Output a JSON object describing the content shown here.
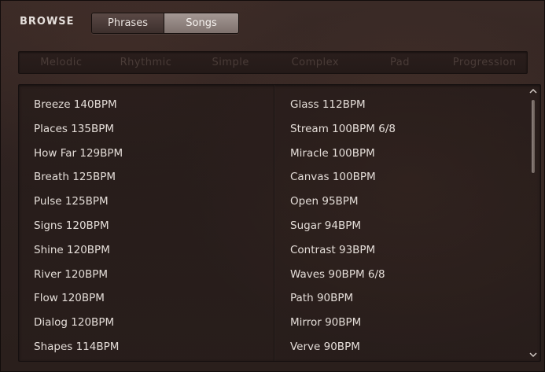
{
  "header": {
    "title": "BROWSE",
    "tabs": [
      {
        "label": "Phrases",
        "selected": false
      },
      {
        "label": "Songs",
        "selected": true
      }
    ]
  },
  "filters": [
    "Melodic",
    "Rhythmic",
    "Simple",
    "Complex",
    "Pad",
    "Progression"
  ],
  "songs": {
    "left": [
      "Breeze 140BPM",
      "Places 135BPM",
      "How Far 129BPM",
      "Breath 125BPM",
      "Pulse 125BPM",
      "Signs 120BPM",
      "Shine 120BPM",
      "River 120BPM",
      "Flow 120BPM",
      "Dialog 120BPM",
      "Shapes 114BPM"
    ],
    "right": [
      "Glass 112BPM",
      "Stream 100BPM 6/8",
      "Miracle 100BPM",
      "Canvas 100BPM",
      "Open 95BPM",
      "Sugar 94BPM",
      "Contrast 93BPM",
      "Waves 90BPM 6/8",
      "Path 90BPM",
      "Mirror 90BPM",
      "Verve 90BPM"
    ]
  },
  "scrollbar": {
    "up_icon": "chevron-up-icon",
    "down_icon": "chevron-down-icon"
  },
  "colors": {
    "background": "#2e2220",
    "text": "#e4ddd8",
    "selected_tab": "#8f827e",
    "disabled_filter": "#4a3c38"
  }
}
